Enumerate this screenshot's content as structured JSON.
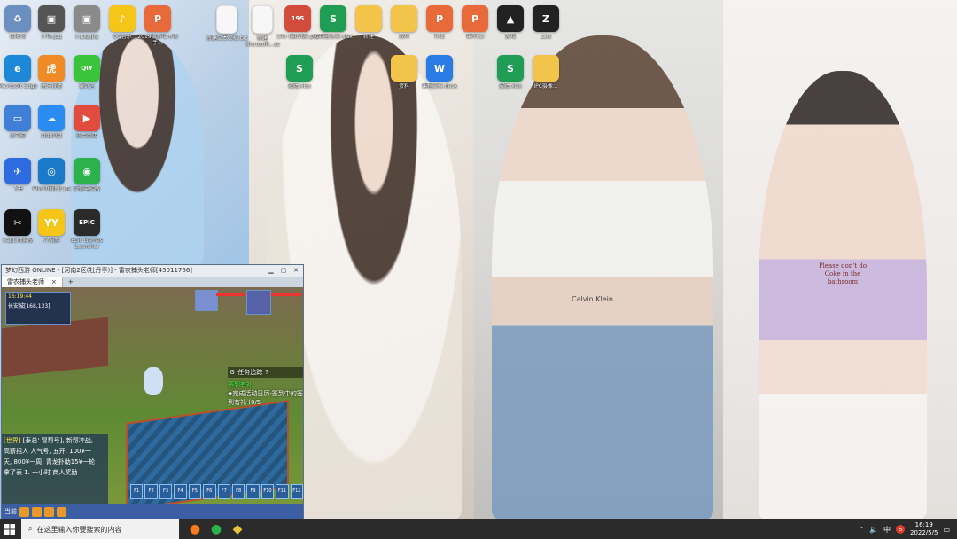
{
  "desktop_icons": [
    {
      "label": "回收站",
      "icon": "recycle-bin-icon",
      "color": "#6b8fbf",
      "glyph": "♻"
    },
    {
      "label": "开场.jpg",
      "icon": "image-file-icon",
      "color": "#555555",
      "glyph": "▣"
    },
    {
      "label": "5.jpg.jpg",
      "icon": "image-file-icon",
      "color": "#8a8a8a",
      "glyph": "▣"
    },
    {
      "label": "QQ音乐",
      "icon": "qq-music-icon",
      "color": "#f5c518",
      "glyph": "♪"
    },
    {
      "label": "2019级新增市场手...",
      "icon": "ppt-file-icon",
      "color": "#e86a3a",
      "glyph": "P"
    },
    {
      "label": "新建文本文档.txt",
      "icon": "text-file-icon",
      "color": "#f7f7f7",
      "glyph": ""
    },
    {
      "label": "新建Microsoft...ss",
      "icon": "text-file-icon",
      "color": "#f7f7f7",
      "glyph": ""
    },
    {
      "label": "195 (翻译版).pdf",
      "icon": "pdf-file-icon",
      "color": "#d34b3a",
      "glyph": "195"
    },
    {
      "label": "成绩登记表.xlsx",
      "icon": "xls-file-icon",
      "color": "#1f9d55",
      "glyph": "S"
    },
    {
      "label": "新建",
      "icon": "folder-icon",
      "color": "#f3c44a",
      "glyph": ""
    },
    {
      "label": "资料",
      "icon": "folder-icon",
      "color": "#f3c44a",
      "glyph": ""
    },
    {
      "label": "作业",
      "icon": "ppt-file-icon",
      "color": "#e86a3a",
      "glyph": "P"
    },
    {
      "label": "课件(1)",
      "icon": "ppt-file-icon",
      "color": "#e86a3a",
      "glyph": "P"
    },
    {
      "label": "游戏",
      "icon": "game-file-icon",
      "color": "#222222",
      "glyph": "▲"
    },
    {
      "label": "工具",
      "icon": "tool-file-icon",
      "color": "#222222",
      "glyph": "Z"
    },
    {
      "label": "Microsoft Edge",
      "icon": "edge-icon",
      "color": "#1e88d8",
      "glyph": "e"
    },
    {
      "label": "虎牙直播",
      "icon": "huya-icon",
      "color": "#f08a24",
      "glyph": "虎"
    },
    {
      "label": "爱奇艺",
      "icon": "iqiyi-icon",
      "color": "#3ac43a",
      "glyph": "QIY"
    },
    {
      "label": "成绩.xlsx",
      "icon": "xls-file-icon",
      "color": "#1f9d55",
      "glyph": "S"
    },
    {
      "label": "资料",
      "icon": "folder-icon",
      "color": "#f3c44a",
      "glyph": ""
    },
    {
      "label": "课程安排.docx",
      "icon": "word-file-icon",
      "color": "#2b7be4",
      "glyph": "W"
    },
    {
      "label": "成绩.xlsx",
      "icon": "xls-file-icon",
      "color": "#1f9d55",
      "glyph": "S"
    },
    {
      "label": "IPC摄像...",
      "icon": "folder-icon",
      "color": "#f3c44a",
      "glyph": ""
    },
    {
      "label": "此电脑",
      "icon": "this-pc-icon",
      "color": "#3f7fd8",
      "glyph": "▭"
    },
    {
      "label": "百度网盘",
      "icon": "baidu-netdisk-icon",
      "color": "#2a8cf0",
      "glyph": "☁"
    },
    {
      "label": "应用商店",
      "icon": "app-store-icon",
      "color": "#e24c3f",
      "glyph": "▶"
    },
    {
      "label": "飞书",
      "icon": "feishu-icon",
      "color": "#2f6be0",
      "glyph": "✈"
    },
    {
      "label": "Win10截图工具",
      "icon": "screenshot-tool-icon",
      "color": "#1b79c9",
      "glyph": "◎"
    },
    {
      "label": "微信电脑版",
      "icon": "wechat-icon",
      "color": "#2bb24c",
      "glyph": "◉"
    },
    {
      "label": "CapCut剪映",
      "icon": "capcut-icon",
      "color": "#111111",
      "glyph": "✂"
    },
    {
      "label": "YY语音",
      "icon": "yy-icon",
      "color": "#f5c518",
      "glyph": "YY"
    },
    {
      "label": "Epic Games Launcher",
      "icon": "epic-games-icon",
      "color": "#2a2a2a",
      "glyph": "EPIC"
    }
  ],
  "wallpaper_text": {
    "shirt_text": "Please don't do Coke in the bathroom",
    "band_text": "Calvin Klein"
  },
  "game": {
    "title": "梦幻西游 ONLINE - [河南2区(牡丹亭)] - 雷农捕头老师[45011766]",
    "tab_label": "雷农捕头老师",
    "tab_close": "×",
    "tab_add": "+",
    "controls": {
      "minimize": "▁",
      "restore": "▢",
      "close": "✕"
    },
    "time": "16:19:44",
    "location": "长安城[168,133]",
    "quest_header": "任务追踪",
    "quest_title": "签到有礼",
    "quest_body": "◆完成活动日历-签到中的签到有礼 (0/5",
    "chat": [
      {
        "tag": "世界",
        "text": "[泰总' 冒帮号], 新帮冲战,"
      },
      {
        "tag": "",
        "text": "高薪招人 人气号, 五开, 100¥一"
      },
      {
        "tag": "",
        "text": "天, 800¥一周, 青龙扑助15¥一轮"
      },
      {
        "tag": "",
        "text": "拿了表 1. 一小时 商人奖励"
      }
    ],
    "skills": [
      "F1",
      "F2",
      "F3",
      "F4",
      "F5",
      "F6",
      "F7",
      "F8",
      "F9",
      "F10",
      "F11",
      "F12"
    ],
    "bottom_label": "当前"
  },
  "taskbar": {
    "search_placeholder": "在这里输入你要搜索的内容",
    "apps": [
      {
        "name": "firefox-icon",
        "color": "#ff7a1a",
        "glyph": "●"
      },
      {
        "name": "wechat-icon",
        "color": "#2bb24c",
        "glyph": "●"
      },
      {
        "name": "menghuan-game-icon",
        "color": "#e8c23a",
        "glyph": "◆"
      }
    ],
    "tray": {
      "ime": "中",
      "wps": "S",
      "time": "16:19",
      "date": "2022/5/5"
    }
  }
}
